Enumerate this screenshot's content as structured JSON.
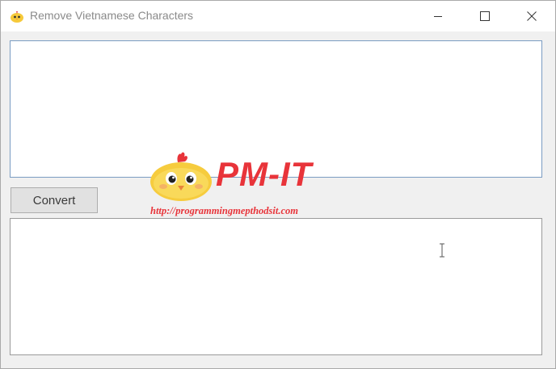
{
  "window": {
    "title": "Remove Vietnamese Characters",
    "icon": "chick-icon",
    "controls": [
      "minimize",
      "maximize",
      "close"
    ]
  },
  "input": {
    "value": ""
  },
  "convert_button": {
    "label": "Convert"
  },
  "output": {
    "value": ""
  },
  "watermark": {
    "title": "PM-IT",
    "url": "http://programmingmepthodsit.com",
    "color": "#e8343a"
  },
  "colors": {
    "window_bg": "#f0f0f0",
    "titlebar_bg": "#ffffff",
    "focus_border": "#7a9cc2",
    "button_bg": "#e1e1e1"
  }
}
